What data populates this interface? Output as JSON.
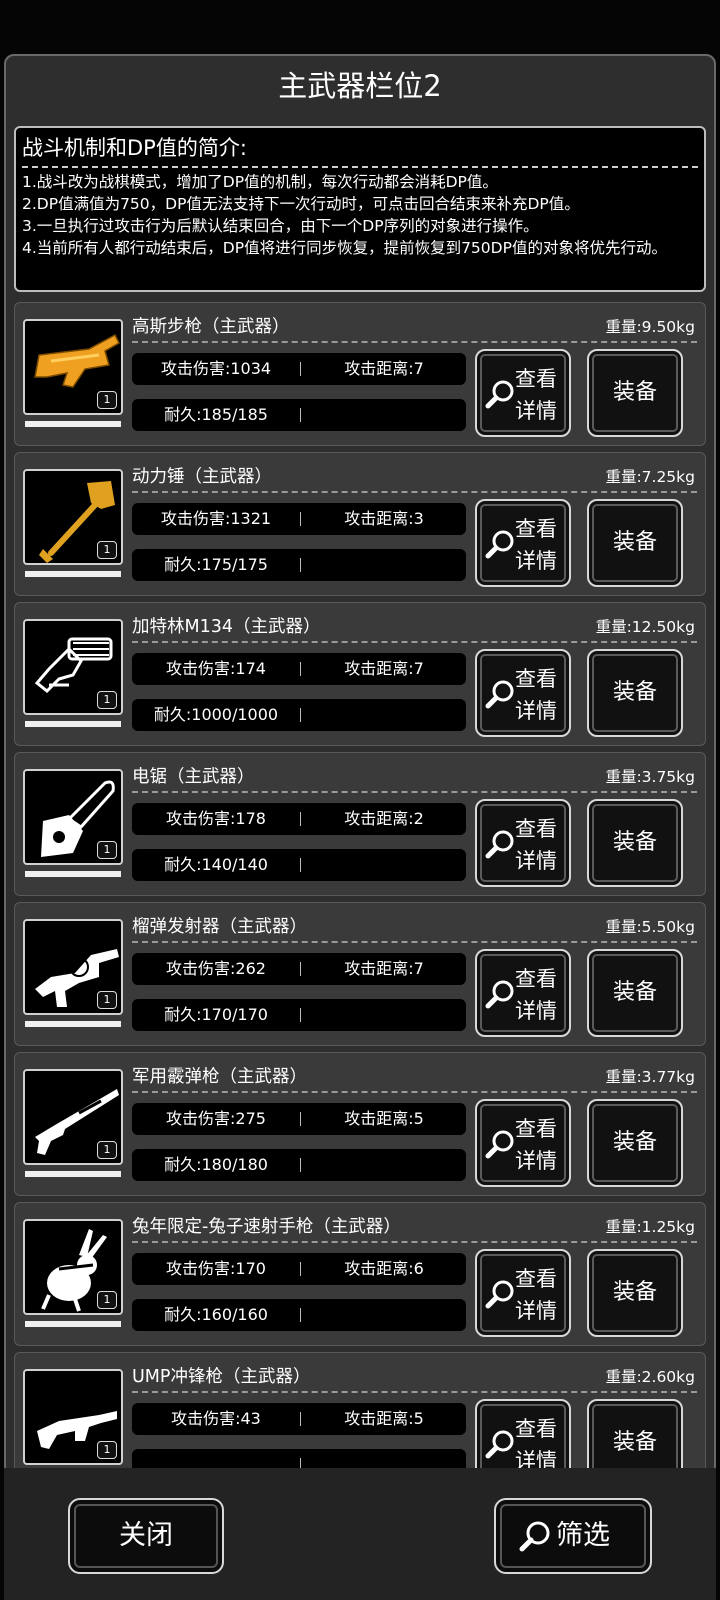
{
  "title": "主武器栏位2",
  "intro": {
    "heading": "战斗机制和DP值的简介:",
    "lines": [
      "1.战斗改为战棋模式，增加了DP值的机制，每次行动都会消耗DP值。",
      "2.DP值满值为750，DP值无法支持下一次行动时，可点击回合结束来补充DP值。",
      "3.一旦执行过攻击行为后默认结束回合，由下一个DP序列的对象进行操作。",
      "4.当前所有人都行动结束后，DP值将进行同步恢复，提前恢复到750DP值的对象将优先行动。"
    ]
  },
  "buttons": {
    "detail_l1": "查看",
    "detail_l2": "详情",
    "equip": "装备"
  },
  "weapons": [
    {
      "name": "高斯步枪（主武器）",
      "weight": "重量:9.50kg",
      "attack": "攻击伤害:1034",
      "range": "攻击距离:7",
      "durability": "耐久:185/185",
      "count": "1",
      "icon": "gauss-rifle-icon",
      "color": "#f0a020"
    },
    {
      "name": "动力锤（主武器）",
      "weight": "重量:7.25kg",
      "attack": "攻击伤害:1321",
      "range": "攻击距离:3",
      "durability": "耐久:175/175",
      "count": "1",
      "icon": "power-hammer-icon",
      "color": "#e0a020"
    },
    {
      "name": "加特林M134（主武器）",
      "weight": "重量:12.50kg",
      "attack": "攻击伤害:174",
      "range": "攻击距离:7",
      "durability": "耐久:1000/1000",
      "count": "1",
      "icon": "gatling-icon",
      "color": "#ffffff"
    },
    {
      "name": "电锯（主武器）",
      "weight": "重量:3.75kg",
      "attack": "攻击伤害:178",
      "range": "攻击距离:2",
      "durability": "耐久:140/140",
      "count": "1",
      "icon": "chainsaw-icon",
      "color": "#ffffff"
    },
    {
      "name": "榴弹发射器（主武器）",
      "weight": "重量:5.50kg",
      "attack": "攻击伤害:262",
      "range": "攻击距离:7",
      "durability": "耐久:170/170",
      "count": "1",
      "icon": "grenade-launcher-icon",
      "color": "#ffffff"
    },
    {
      "name": "军用霰弹枪（主武器）",
      "weight": "重量:3.77kg",
      "attack": "攻击伤害:275",
      "range": "攻击距离:5",
      "durability": "耐久:180/180",
      "count": "1",
      "icon": "shotgun-icon",
      "color": "#ffffff"
    },
    {
      "name": "兔年限定-兔子速射手枪（主武器）",
      "weight": "重量:1.25kg",
      "attack": "攻击伤害:170",
      "range": "攻击距离:6",
      "durability": "耐久:160/160",
      "count": "1",
      "icon": "rabbit-pistol-icon",
      "color": "#ffffff"
    },
    {
      "name": "UMP冲锋枪（主武器）",
      "weight": "重量:2.60kg",
      "attack": "攻击伤害:43",
      "range": "攻击距离:5",
      "durability": "",
      "count": "1",
      "icon": "smg-icon",
      "color": "#ffffff"
    }
  ],
  "footer": {
    "close": "关闭",
    "filter": "筛选"
  }
}
